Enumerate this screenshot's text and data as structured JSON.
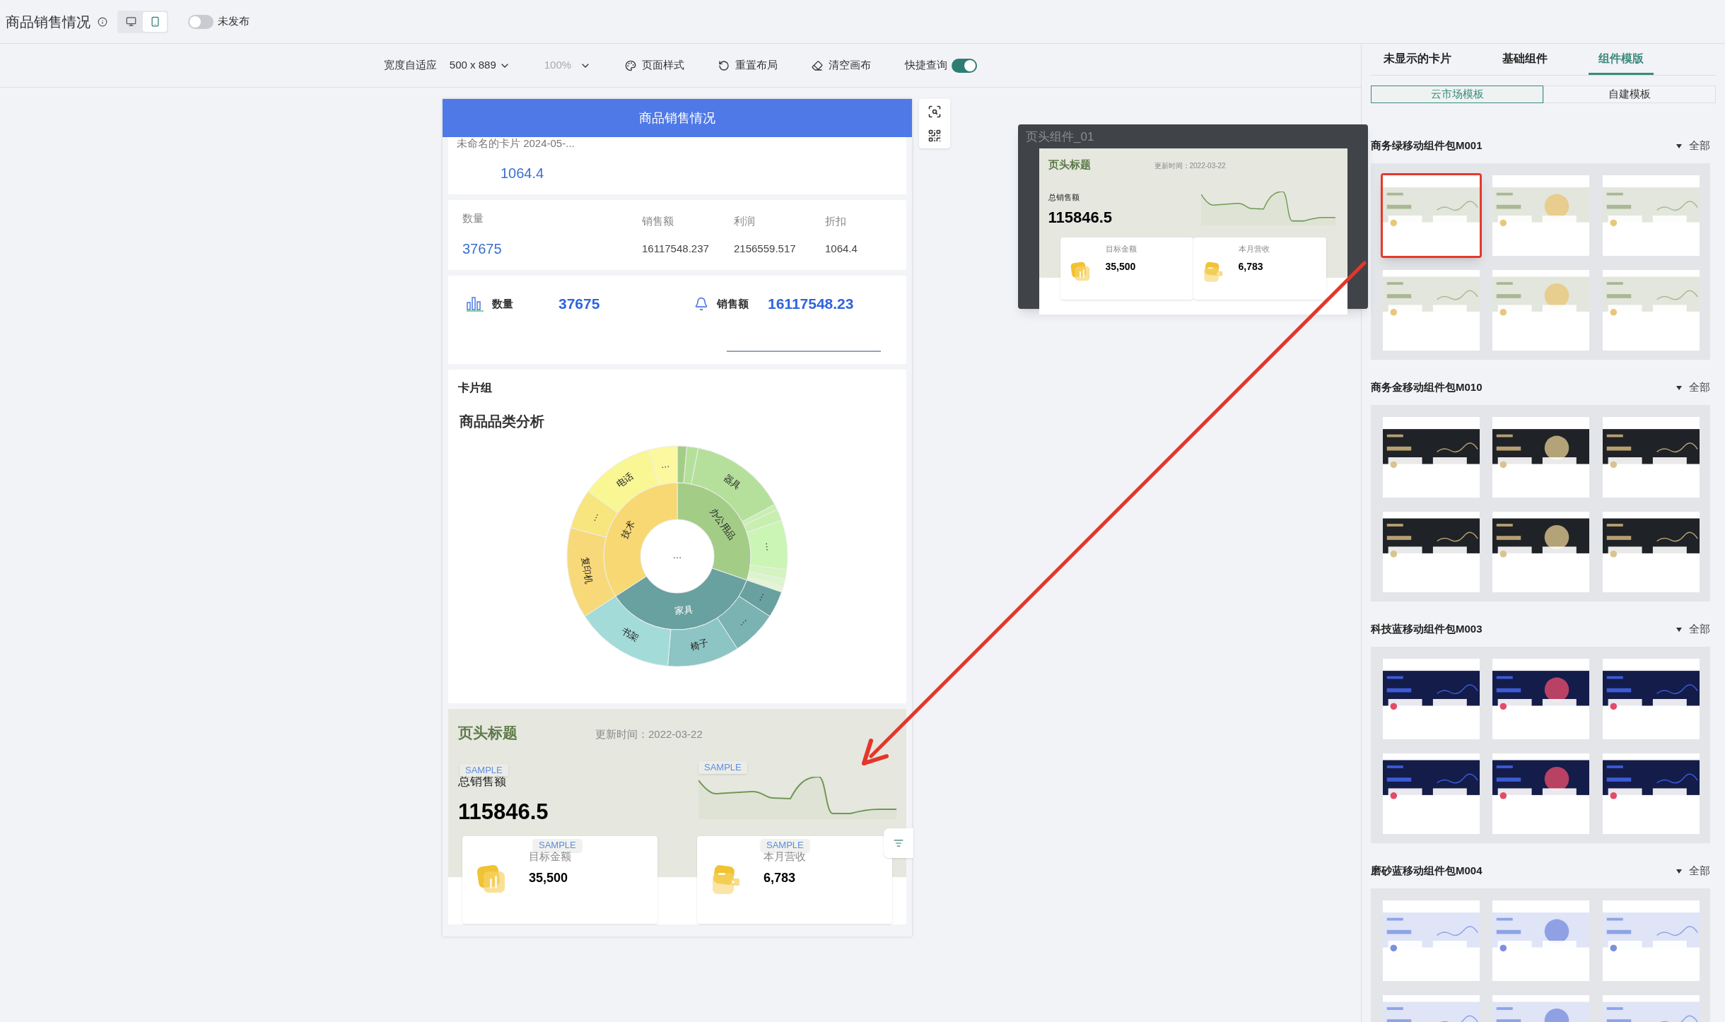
{
  "header": {
    "title": "商品销售情况",
    "devices": [
      {
        "kind": "desktop",
        "selected": false
      },
      {
        "kind": "mobile",
        "selected": true
      }
    ],
    "publish": {
      "on": false,
      "label": "未发布"
    }
  },
  "toolbar": {
    "width_mode": "宽度自适应",
    "size": "500 x 889",
    "zoom": {
      "label": "100%",
      "disabled": true
    },
    "actions": [
      {
        "kind": "style",
        "label": "页面样式"
      },
      {
        "kind": "reset",
        "label": "重置布局"
      },
      {
        "kind": "clear",
        "label": "清空画布"
      }
    ],
    "quick_query": {
      "label": "快捷查询",
      "on": true
    }
  },
  "phone": {
    "title": "商品销售情况",
    "card_1": {
      "title": "未命名的卡片 2024-05-...",
      "value": "1064.4"
    },
    "table": {
      "columns": [
        "数量",
        "销售额",
        "利润",
        "折扣"
      ],
      "values": [
        "37675",
        "16117548.237",
        "2156559.517",
        "1064.4"
      ]
    },
    "kpis": [
      {
        "kind": "bars",
        "label": "数量",
        "value": "37675"
      },
      {
        "kind": "bell",
        "label": "销售额",
        "value": "16117548.23"
      }
    ],
    "group": {
      "title": "卡片组",
      "chart_title": "商品品类分析",
      "center_label": "…",
      "inner": [
        {
          "label": "办公用品",
          "color": "#a3cd87"
        },
        {
          "label": "家具",
          "color": "#68a19f"
        },
        {
          "label": "技术",
          "color": "#f8d873"
        }
      ],
      "outer": [
        {
          "color": "#a3cd87"
        },
        {
          "color": "#b5e09b"
        },
        {
          "label": "器具",
          "color": "#b5e09b"
        },
        {
          "color": "#c8eeb0"
        },
        {
          "color": "#c8eeb0"
        },
        {
          "label": "…",
          "color": "#cbf5b4"
        },
        {
          "color": "#d3f3bf"
        },
        {
          "color": "#dcf4cb"
        },
        {
          "color": "#e3f5d5"
        },
        {
          "label": "…",
          "color": "#68a19f"
        },
        {
          "label": "…",
          "color": "#7ab3b2"
        },
        {
          "label": "椅子",
          "color": "#8cc5c4"
        },
        {
          "label": "书架",
          "color": "#a3dbd9"
        },
        {
          "label": "复印机",
          "color": "#f8d97a"
        },
        {
          "label": "…",
          "color": "#f7e57e"
        },
        {
          "label": "电话",
          "color": "#f9f793"
        },
        {
          "label": "…",
          "color": "#fbf89f"
        }
      ]
    },
    "header_card": {
      "title": "页头标题",
      "updated": "更新时间：2022-03-22",
      "metric_label": "总销售额",
      "metric_value": "115846.5",
      "cards": [
        {
          "kind": "chart",
          "label": "目标金额",
          "value": "35,500"
        },
        {
          "kind": "wallet",
          "label": "本月营收",
          "value": "6,783"
        }
      ],
      "sample_tags": [
        "SAMPLE",
        "SAMPLE",
        "SAMPLE",
        "SAMPLE"
      ]
    }
  },
  "drag_preview": {
    "name": "页头组件_01",
    "title": "页头标题",
    "updated": "更新时间：2022-03-22",
    "metric_label": "总销售额",
    "metric_value": "115846.5",
    "cards": [
      {
        "kind": "chart",
        "label": "目标金额",
        "value": "35,500"
      },
      {
        "kind": "wallet",
        "label": "本月营收",
        "value": "6,783"
      }
    ]
  },
  "panel": {
    "tabs": [
      {
        "label": "未显示的卡片",
        "selected": false
      },
      {
        "label": "基础组件",
        "selected": false
      },
      {
        "label": "组件模版",
        "selected": true
      }
    ],
    "sources": [
      {
        "label": "云市场模板",
        "selected": true
      },
      {
        "label": "自建模板",
        "selected": false
      }
    ],
    "sections": [
      {
        "title": "商务绿移动组件包M001",
        "filter": "全部",
        "templates": [
          {
            "highlighted": true
          },
          {
            "highlighted": false
          },
          {
            "highlighted": false
          },
          {
            "highlighted": false
          },
          {
            "highlighted": false
          },
          {
            "highlighted": false
          }
        ]
      },
      {
        "title": "商务金移动组件包M010",
        "filter": "全部",
        "templates": [
          {
            "highlighted": false
          },
          {
            "highlighted": false
          },
          {
            "highlighted": false
          },
          {
            "highlighted": false
          },
          {
            "highlighted": false
          },
          {
            "highlighted": false
          }
        ]
      },
      {
        "title": "科技蓝移动组件包M003",
        "filter": "全部",
        "templates": [
          {
            "highlighted": false
          },
          {
            "highlighted": false
          },
          {
            "highlighted": false
          },
          {
            "highlighted": false
          },
          {
            "highlighted": false
          },
          {
            "highlighted": false
          }
        ]
      },
      {
        "title": "磨砂蓝移动组件包M004",
        "filter": "全部",
        "templates": [
          {
            "highlighted": false
          },
          {
            "highlighted": false
          },
          {
            "highlighted": false
          },
          {
            "highlighted": false
          },
          {
            "highlighted": false
          },
          {
            "highlighted": false
          }
        ]
      }
    ]
  }
}
